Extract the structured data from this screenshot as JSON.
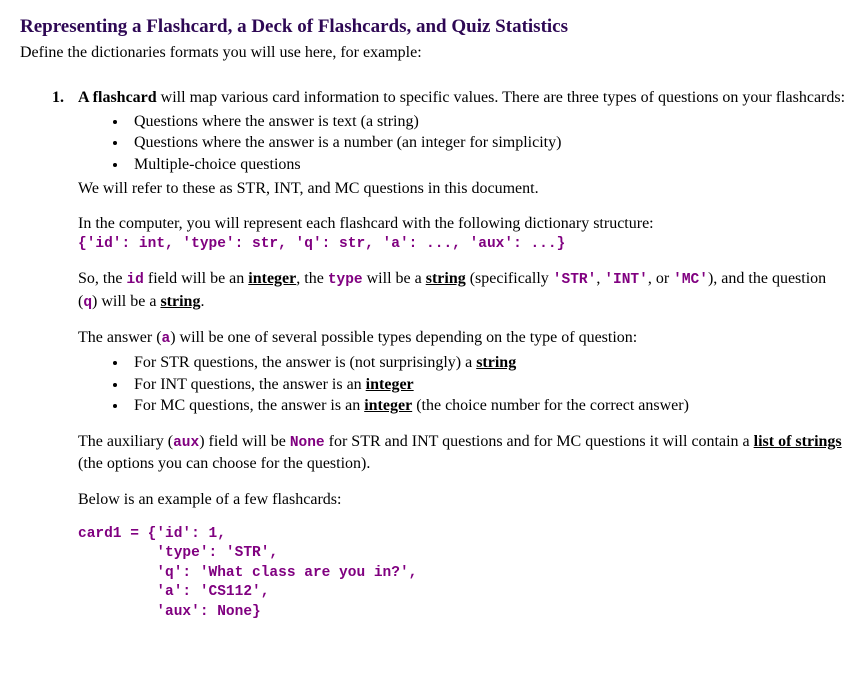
{
  "heading": "Representing a Flashcard, a Deck of Flashcards, and Quiz Statistics",
  "subheading": "Define the dictionaries formats you will use here, for example:",
  "item": {
    "number": "1.",
    "lead_bold": "A flashcard",
    "lead_rest": " will map various card information to specific values. There are three types of questions on your flashcards:",
    "bullets1": [
      "Questions where the answer is text (a string)",
      "Questions where the answer is a number (an integer for simplicity)",
      "Multiple-choice questions"
    ],
    "after_bullets1": "We will refer to these as STR, INT, and MC questions in this document.",
    "p2": "In the computer, you will represent each flashcard with the following dictionary structure:",
    "dict_code": "{'id': int, 'type': str, 'q': str, 'a': ..., 'aux': ...}",
    "p3": {
      "t1": "So, the ",
      "id": "id",
      "t2": " field will be an ",
      "integer": "integer",
      "t3": ", the ",
      "type": "type",
      "t4": " will be a ",
      "string": "string",
      "t5": " (specifically ",
      "str_lit": "'STR'",
      "t6": ", ",
      "int_lit": "'INT'",
      "t7": ", or ",
      "mc_lit": "'MC'",
      "t8": "), and the question (",
      "q": "q",
      "t9": ") will be a ",
      "string2": "string",
      "t10": "."
    },
    "p4": {
      "t1": "The answer (",
      "a": "a",
      "t2": ") will be one of several possible types depending on the type of question:"
    },
    "bullets2": {
      "b1": {
        "pre": "For STR questions, the answer is (not surprisingly) a ",
        "u": "string"
      },
      "b2": {
        "pre": "For INT questions, the answer is an ",
        "u": "integer"
      },
      "b3": {
        "pre": "For MC questions, the answer is an ",
        "u": "integer",
        "post": " (the choice number for the correct answer)"
      }
    },
    "p5": {
      "t1": "The auxiliary (",
      "aux": "aux",
      "t2": ") field will be ",
      "none": "None",
      "t3": " for STR and INT questions and for MC questions it will contain a ",
      "list": "list of strings",
      "t4": " (the options you can choose for the question)."
    },
    "p6": "Below is an example of a few flashcards:",
    "code_example": "card1 = {'id': 1,\n         'type': 'STR',\n         'q': 'What class are you in?',\n         'a': 'CS112',\n         'aux': None}"
  }
}
